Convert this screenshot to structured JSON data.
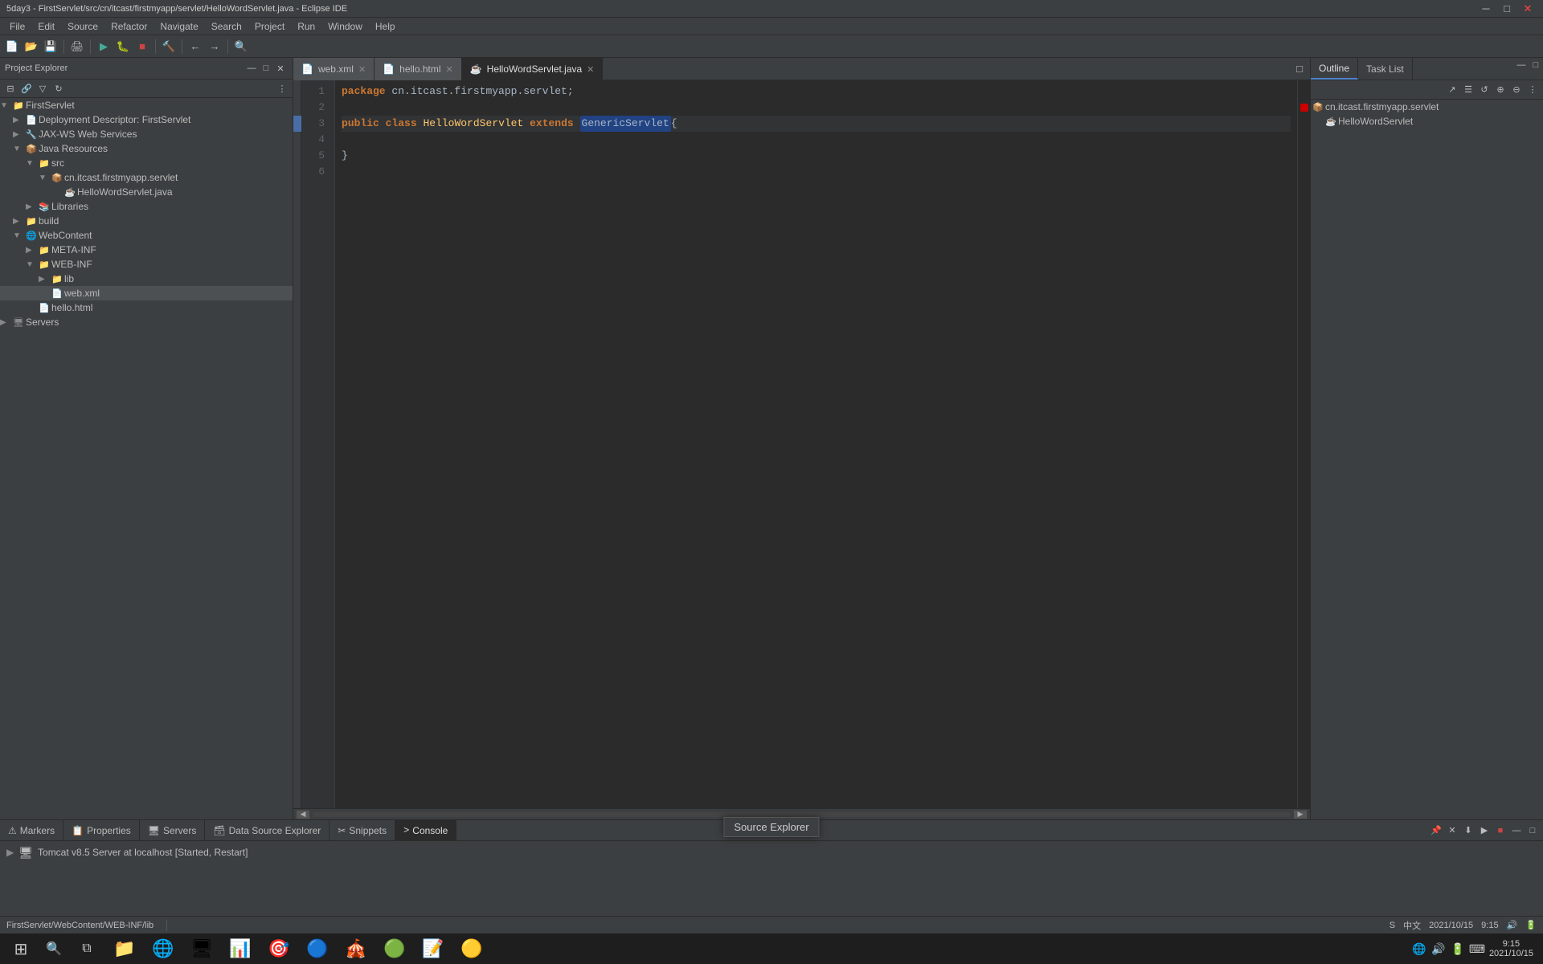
{
  "titlebar": {
    "text": "5day3 - FirstServlet/src/cn/itcast/firstmyapp/servlet/HelloWordServlet.java - Eclipse IDE"
  },
  "menubar": {
    "items": [
      "File",
      "Edit",
      "Source",
      "Refactor",
      "Navigate",
      "Search",
      "Project",
      "Run",
      "Window",
      "Help"
    ]
  },
  "project_explorer": {
    "title": "Project Explorer",
    "tree": [
      {
        "id": "firstservlet",
        "label": "FirstServlet",
        "level": 0,
        "icon": "📁",
        "expanded": true
      },
      {
        "id": "deployment",
        "label": "Deployment Descriptor: FirstServlet",
        "level": 1,
        "icon": "📄"
      },
      {
        "id": "jaxws",
        "label": "JAX-WS Web Services",
        "level": 1,
        "icon": "🔧"
      },
      {
        "id": "java-resources",
        "label": "Java Resources",
        "level": 1,
        "icon": "📦",
        "expanded": true
      },
      {
        "id": "src",
        "label": "src",
        "level": 2,
        "icon": "📁",
        "expanded": true
      },
      {
        "id": "cn-package",
        "label": "cn.itcast.firstmyapp.servlet",
        "level": 3,
        "icon": "📦",
        "expanded": true
      },
      {
        "id": "hellowordservlet",
        "label": "HelloWordServlet.java",
        "level": 4,
        "icon": "☕"
      },
      {
        "id": "libraries",
        "label": "Libraries",
        "level": 2,
        "icon": "📚"
      },
      {
        "id": "build",
        "label": "build",
        "level": 1,
        "icon": "📁"
      },
      {
        "id": "webcontent",
        "label": "WebContent",
        "level": 1,
        "icon": "🌐",
        "expanded": true
      },
      {
        "id": "meta-inf",
        "label": "META-INF",
        "level": 2,
        "icon": "📁"
      },
      {
        "id": "web-inf",
        "label": "WEB-INF",
        "level": 2,
        "icon": "📁",
        "expanded": true
      },
      {
        "id": "lib",
        "label": "lib",
        "level": 3,
        "icon": "📁",
        "expanded": false
      },
      {
        "id": "webxml",
        "label": "web.xml",
        "level": 3,
        "icon": "📄",
        "selected": true
      },
      {
        "id": "hellohtml",
        "label": "hello.html",
        "level": 2,
        "icon": "📄"
      },
      {
        "id": "servers",
        "label": "Servers",
        "level": 0,
        "icon": "🖥️"
      }
    ]
  },
  "editor": {
    "tabs": [
      {
        "id": "webxml",
        "label": "web.xml",
        "active": false,
        "icon": "📄"
      },
      {
        "id": "hellohtml",
        "label": "hello.html",
        "active": false,
        "icon": "📄"
      },
      {
        "id": "hellowordservlet",
        "label": "HelloWordServlet.java",
        "active": true,
        "icon": "☕"
      }
    ],
    "code_lines": [
      {
        "num": 1,
        "content": "package cn.itcast.firstmyapp.servlet;",
        "has_bookmark": false
      },
      {
        "num": 2,
        "content": "",
        "has_bookmark": false
      },
      {
        "num": 3,
        "content": "public class HelloWordServlet extends GenericServlet{",
        "has_bookmark": true
      },
      {
        "num": 4,
        "content": "",
        "has_bookmark": false
      },
      {
        "num": 5,
        "content": "}",
        "has_bookmark": false
      },
      {
        "num": 6,
        "content": "",
        "has_bookmark": false
      }
    ]
  },
  "outline": {
    "title": "Outline",
    "task_list": "Task List",
    "tree": [
      {
        "label": "cn.itcast.firstmyapp.servlet",
        "level": 0,
        "icon": "📦"
      },
      {
        "label": "HelloWordServlet",
        "level": 1,
        "icon": "☕"
      }
    ]
  },
  "bottom_panel": {
    "tabs": [
      {
        "id": "markers",
        "label": "Markers",
        "active": false,
        "icon": "⚠"
      },
      {
        "id": "properties",
        "label": "Properties",
        "active": false,
        "icon": "📋"
      },
      {
        "id": "servers",
        "label": "Servers",
        "active": false,
        "icon": "🖥"
      },
      {
        "id": "datasource",
        "label": "Data Source Explorer",
        "active": false,
        "icon": "🗃"
      },
      {
        "id": "snippets",
        "label": "Snippets",
        "active": false,
        "icon": "✂"
      },
      {
        "id": "console",
        "label": "Console",
        "active": true,
        "icon": ">"
      }
    ],
    "console_content": [
      {
        "text": "Tomcat v8.5 Server at localhost  [Started, Restart]",
        "icon": "🖥"
      }
    ]
  },
  "statusbar": {
    "path": "FirstServlet/WebContent/WEB-INF/lib",
    "encoding": "中文",
    "datetime": "2021/10/15",
    "time": "9:15"
  },
  "source_explorer": {
    "label": "Source Explorer"
  },
  "taskbar": {
    "start_icon": "⊞",
    "search_icon": "🔍",
    "apps": [
      "📁",
      "🌐",
      "🖥",
      "📊",
      "🎯",
      "🔵",
      "🎪",
      "🟢",
      "📝",
      "🟡"
    ],
    "right_icons": [
      "🌐",
      "🔊",
      "🔋",
      "⌨"
    ],
    "time": "9:15",
    "date": "2021/10/15"
  }
}
